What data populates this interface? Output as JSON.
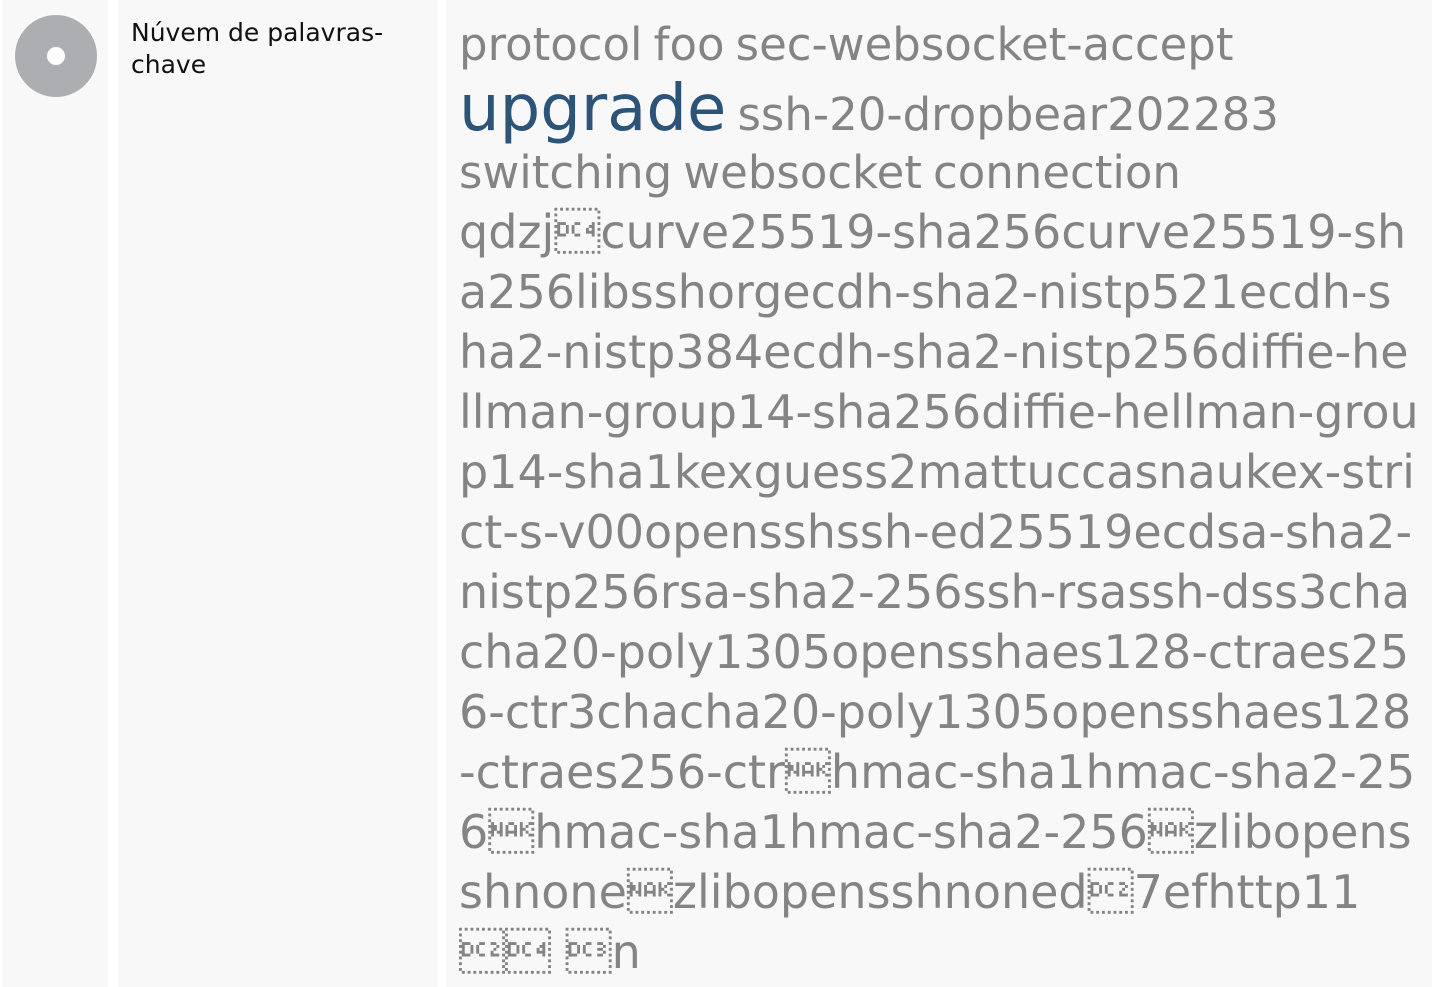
{
  "label": "Núvem de palavras-chave",
  "cloud": {
    "words": [
      "protocol",
      "foo",
      "sec-websocket-accept"
    ],
    "highlight": "upgrade",
    "word_ssh": "ssh-20-dropbear202283",
    "words2": [
      "switching",
      "websocket",
      "connection"
    ],
    "long_text": "qdzj\u0014curve25519-sha256curve25519-sha256libsshorgecdh-sha2-nistp521ecdh-sha2-nistp384ecdh-sha2-nistp256diffie-hellman-group14-sha256diffie-hellman-group14-sha1kexguess2mattuccasnaukex-strict-s-v00opensshssh-ed25519ecdsa-sha2-nistp256rsa-sha2-256ssh-rsassh-dss3chacha20-poly1305opensshaes128-ctraes256-ctr3chacha20-poly1305opensshaes128-ctraes256-ctr\u0015hmac-sha1hmac-sha2-256\u0015hmac-sha1hmac-sha2-256\u0015zlibopensshnone\u0015zlibopensshnoned\u00127efhttp11 \u0012\u0014 \u0013n"
  },
  "colors": {
    "panel": "#f8f8f8",
    "icon": "#acaeb1",
    "word": "#848484",
    "highlight": "#2c5478"
  },
  "icons": {
    "row_icon": "disc-icon"
  }
}
